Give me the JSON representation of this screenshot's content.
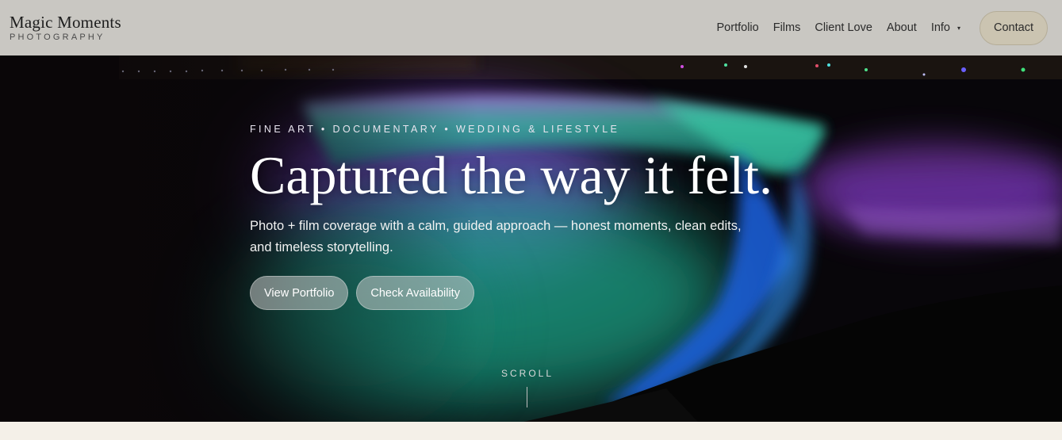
{
  "brand": {
    "name": "Magic Moments",
    "tagline": "PHOTOGRAPHY"
  },
  "nav": {
    "items": [
      "Portfolio",
      "Films",
      "Client Love",
      "About",
      "Info"
    ],
    "info_caret": "▾",
    "contact_label": "Contact"
  },
  "hero": {
    "eyebrow": "FINE ART • DOCUMENTARY • WEDDING & LIFESTYLE",
    "headline": "Captured the way it felt.",
    "subtext": "Photo + film coverage with a calm, guided approach — honest moments, clean edits, and timeless storytelling.",
    "primary_button": "View Portfolio",
    "secondary_button": "Check Availability",
    "scroll_label": "SCROLL"
  },
  "colors": {
    "header_bg": "#c9c7c2",
    "contact_bg": "#cbc4b1",
    "page_bg": "#f4f0e8",
    "hero_teal": "#1fae8f",
    "hero_purple": "#7a3fd0",
    "hero_blue": "#1e4fd8"
  }
}
